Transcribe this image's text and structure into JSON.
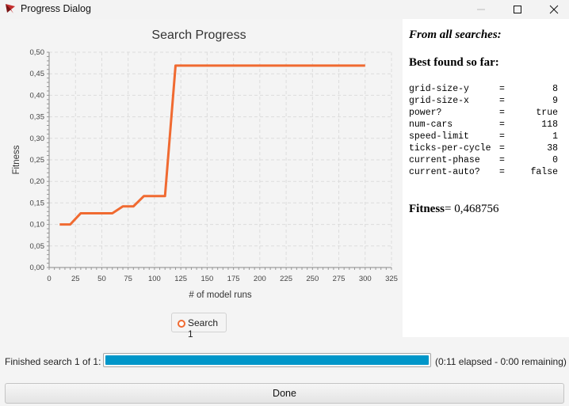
{
  "window": {
    "title": "Progress Dialog"
  },
  "chart_data": {
    "type": "line",
    "title": "Search Progress",
    "xlabel": "# of model runs",
    "ylabel": "Fitness",
    "xlim": [
      0,
      325
    ],
    "ylim": [
      0,
      0.5
    ],
    "x_ticks": [
      "0",
      "25",
      "50",
      "75",
      "100",
      "125",
      "150",
      "175",
      "200",
      "225",
      "250",
      "275",
      "300",
      "325"
    ],
    "y_ticks": [
      "0,00",
      "0,05",
      "0,10",
      "0,15",
      "0,20",
      "0,25",
      "0,30",
      "0,35",
      "0,40",
      "0,45",
      "0,50"
    ],
    "grid": true,
    "legend": "bottom",
    "series": [
      {
        "name": "Search 1",
        "color": "#f06a31",
        "x": [
          10,
          20,
          30,
          60,
          70,
          80,
          90,
          110,
          120,
          300
        ],
        "y": [
          0.1,
          0.1,
          0.126,
          0.126,
          0.142,
          0.142,
          0.166,
          0.166,
          0.469,
          0.469
        ]
      }
    ]
  },
  "side_panel": {
    "heading": "From all searches:",
    "subheading": "Best found so far:",
    "params": [
      {
        "name": "grid-size-y",
        "eq": "=",
        "value": "8"
      },
      {
        "name": "grid-size-x",
        "eq": "=",
        "value": "9"
      },
      {
        "name": "power?",
        "eq": "=",
        "value": "true"
      },
      {
        "name": "num-cars",
        "eq": "=",
        "value": "118"
      },
      {
        "name": "speed-limit",
        "eq": "=",
        "value": "1"
      },
      {
        "name": "ticks-per-cycle",
        "eq": "=",
        "value": "38"
      },
      {
        "name": "current-phase",
        "eq": "=",
        "value": "0"
      },
      {
        "name": "current-auto?",
        "eq": "=",
        "value": "false"
      }
    ],
    "fitness_label": "Fitness",
    "fitness_value": "= 0,468756"
  },
  "status": {
    "label": "Finished search 1 of 1:",
    "progress": 1.0,
    "elapsed_text": "(0:11 elapsed - 0:00 remaining)"
  },
  "done_label": "Done"
}
